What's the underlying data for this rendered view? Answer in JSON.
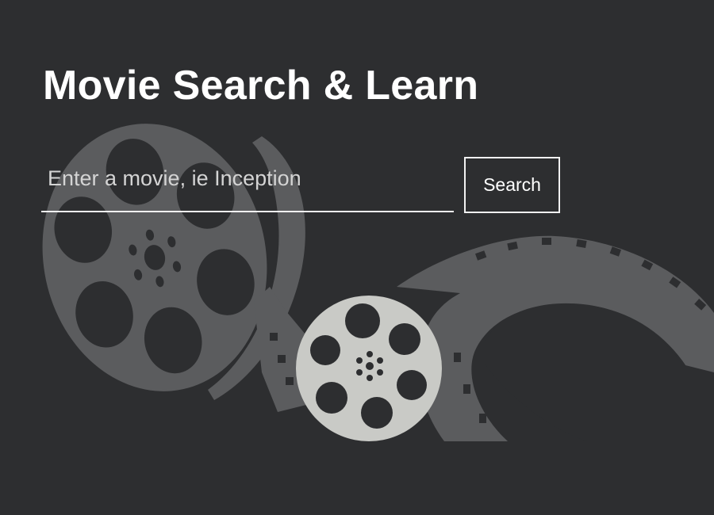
{
  "header": {
    "title": "Movie Search & Learn"
  },
  "search": {
    "placeholder": "Enter a movie, ie Inception",
    "value": "",
    "button_label": "Search"
  },
  "colors": {
    "background": "#2d2e30",
    "text": "#ffffff",
    "art_dark": "#5b5c5e",
    "art_light": "#c9cac6"
  },
  "illustration": {
    "icon": "film-reel-icon"
  }
}
